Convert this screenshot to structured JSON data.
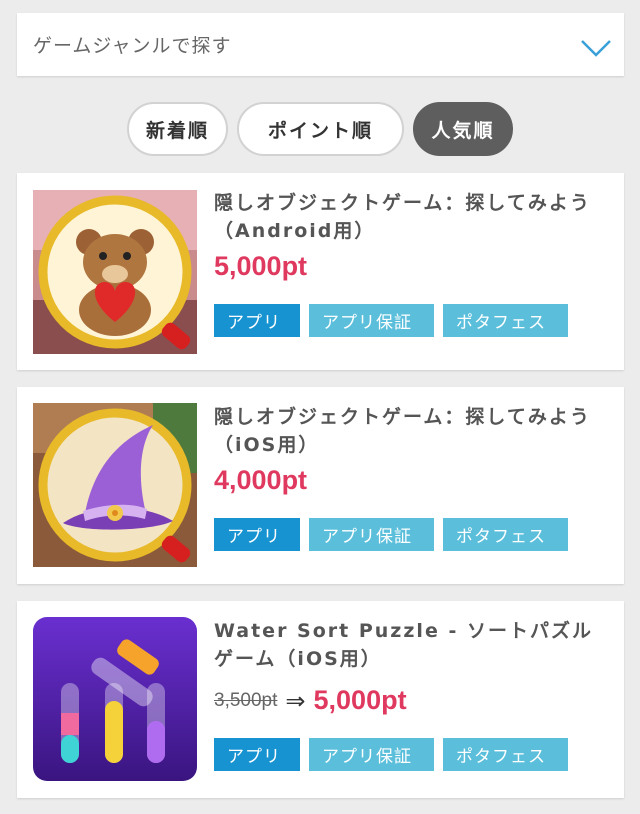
{
  "genre_select": {
    "label": "ゲームジャンルで探す"
  },
  "sort_tabs": [
    {
      "label": "新着順",
      "active": false
    },
    {
      "label": "ポイント順",
      "active": false
    },
    {
      "label": "人気順",
      "active": true
    }
  ],
  "items": [
    {
      "title": "隠しオブジェクトゲーム：探してみよう（Android用）",
      "price": "5,000pt",
      "thumbnail_icon": "teddy-bear-heart-magnifier",
      "tags": [
        "アプリ",
        "アプリ保証",
        "ポタフェス"
      ]
    },
    {
      "title": "隠しオブジェクトゲーム：探してみよう（iOS用）",
      "price": "4,000pt",
      "thumbnail_icon": "witch-hat-magnifier",
      "tags": [
        "アプリ",
        "アプリ保証",
        "ポタフェス"
      ]
    },
    {
      "title": "Water Sort Puzzle - ソートパズルゲーム（iOS用）",
      "old_price": "3,500pt",
      "arrow": "⇒",
      "price": "5,000pt",
      "thumbnail_icon": "test-tubes",
      "tags": [
        "アプリ",
        "アプリ保証",
        "ポタフェス"
      ]
    }
  ],
  "colors": {
    "price": "#e0395f",
    "tag_primary": "#1793d1",
    "tag_secondary": "#5bbfdb",
    "active_tab": "#5e5e5e",
    "chevron": "#3a9fd8"
  }
}
